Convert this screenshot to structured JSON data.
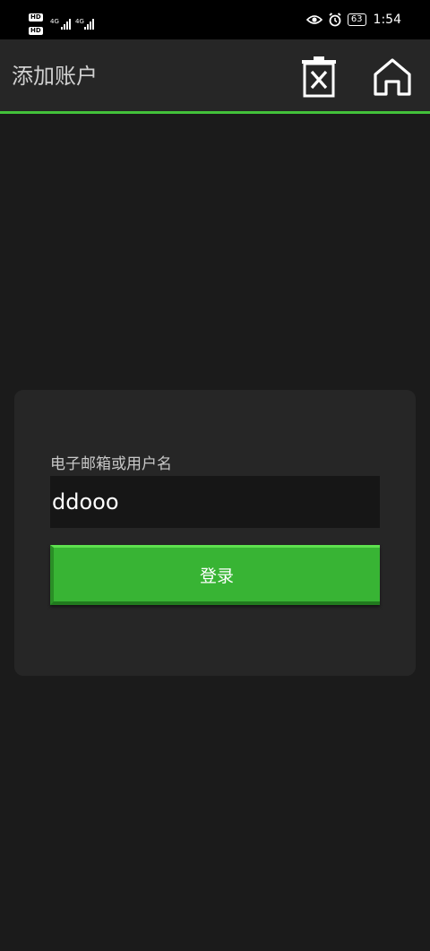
{
  "status_bar": {
    "hd_1": "HD",
    "hd_2": "HD",
    "network_1": "4G",
    "network_2": "4G",
    "battery": "63",
    "time": "1:54",
    "icons": [
      "eye-icon",
      "alarm-icon"
    ]
  },
  "app_bar": {
    "title": "添加账户",
    "actions": [
      "delete-icon",
      "home-icon"
    ]
  },
  "form": {
    "field_label": "电子邮箱或用户名",
    "field_value": "ddooo",
    "login_label": "登录"
  },
  "colors": {
    "accent": "#43c13a",
    "button": "#38b434",
    "background": "#1b1b1b",
    "card": "#262626"
  }
}
